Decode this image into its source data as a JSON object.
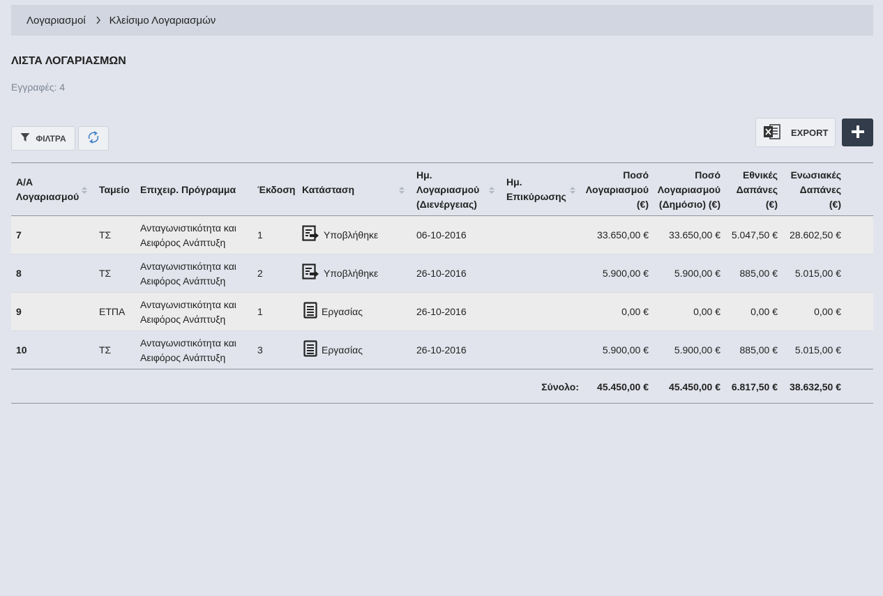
{
  "breadcrumb": {
    "items": [
      "Λογαριασμοί",
      "Κλείσιμο Λογαριασμών"
    ]
  },
  "page": {
    "title": "ΛΙΣΤΑ ΛΟΓΑΡΙΑΣΜΩΝ",
    "records": "Εγγραφές: 4"
  },
  "toolbar": {
    "filters_label": "ΦΙΛΤΡΑ",
    "export_label": "EXPORT"
  },
  "table": {
    "headers": {
      "aa": "Α/Α Λογαριασμού",
      "tameio": "Ταμείο",
      "program": "Επιχειρ. Πρόγραμμα",
      "version": "Έκδοση",
      "status": "Κατάσταση",
      "date_account": "Ημ. Λογαριασμού (Διενέργειας)",
      "date_confirm": "Ημ. Επικύρωσης",
      "amount": "Ποσό Λογαριασμού (€)",
      "amount_public": "Ποσό Λογαριασμού (Δημόσιο) (€)",
      "national": "Εθνικές Δαπάνες (€)",
      "eu": "Ενωσιακές Δαπάνες (€)"
    },
    "rows": [
      {
        "aa": "7",
        "tameio": "ΤΣ",
        "program1": "Ανταγωνιστικότητα και",
        "program2": "Αειφόρος Ανάπτυξη",
        "version": "1",
        "status": "Υποβλήθηκε",
        "status_icon": "submitted-icon",
        "date_account": "06-10-2016",
        "date_confirm": "",
        "amount": "33.650,00 €",
        "amount_public": "33.650,00 €",
        "national": "5.047,50 €",
        "eu": "28.602,50 €"
      },
      {
        "aa": "8",
        "tameio": "ΤΣ",
        "program1": "Ανταγωνιστικότητα και",
        "program2": "Αειφόρος Ανάπτυξη",
        "version": "2",
        "status": "Υποβλήθηκε",
        "status_icon": "submitted-icon",
        "date_account": "26-10-2016",
        "date_confirm": "",
        "amount": "5.900,00 €",
        "amount_public": "5.900,00 €",
        "national": "885,00 €",
        "eu": "5.015,00 €"
      },
      {
        "aa": "9",
        "tameio": "ΕΤΠΑ",
        "program1": "Ανταγωνιστικότητα και",
        "program2": "Αειφόρος Ανάπτυξη",
        "version": "1",
        "status": "Εργασίας",
        "status_icon": "draft-icon",
        "date_account": "26-10-2016",
        "date_confirm": "",
        "amount": "0,00 €",
        "amount_public": "0,00 €",
        "national": "0,00 €",
        "eu": "0,00 €"
      },
      {
        "aa": "10",
        "tameio": "ΤΣ",
        "program1": "Ανταγωνιστικότητα και",
        "program2": "Αειφόρος Ανάπτυξη",
        "version": "3",
        "status": "Εργασίας",
        "status_icon": "draft-icon",
        "date_account": "26-10-2016",
        "date_confirm": "",
        "amount": "5.900,00 €",
        "amount_public": "5.900,00 €",
        "national": "885,00 €",
        "eu": "5.015,00 €"
      }
    ],
    "totals": {
      "label": "Σύνολο:",
      "amount": "45.450,00 €",
      "amount_public": "45.450,00 €",
      "national": "6.817,50 €",
      "eu": "38.632,50 €"
    }
  },
  "colors": {
    "background": "#e1e4ec",
    "breadcrumb_bg": "#d2d6e0",
    "row_alt": "#ececec",
    "add_button": "#323c4a",
    "refresh_icon": "#3b7fc4",
    "excel_icon": "#333333"
  }
}
